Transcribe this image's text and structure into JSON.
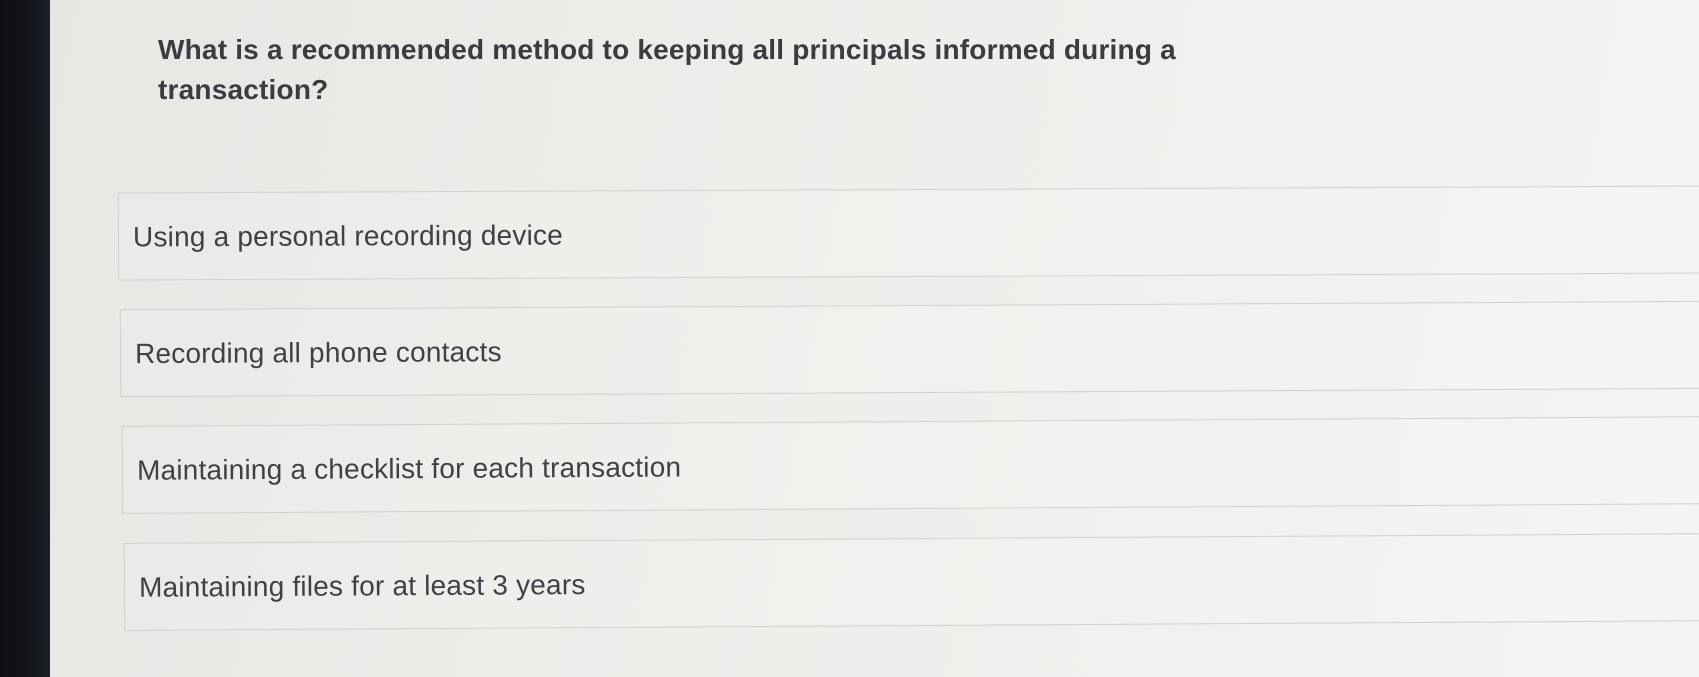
{
  "question": {
    "text": "What is a recommended method to keeping all principals informed during a transaction?"
  },
  "options": [
    {
      "label": "Using a personal recording device"
    },
    {
      "label": "Recording all phone contacts"
    },
    {
      "label": "Maintaining a checklist for each transaction"
    },
    {
      "label": "Maintaining files for at least 3 years"
    }
  ]
}
